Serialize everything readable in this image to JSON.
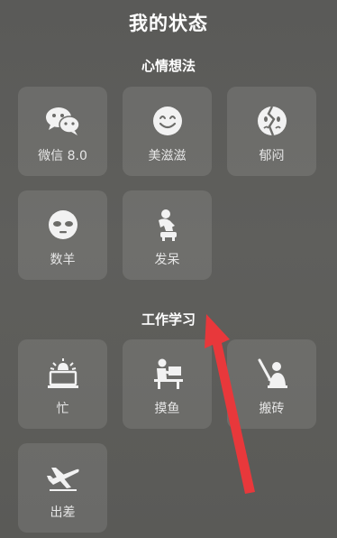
{
  "header": {
    "title": "我的状态"
  },
  "sections": [
    {
      "title": "心情想法",
      "items": [
        {
          "label": "微信 8.0",
          "icon": "wechat-icon"
        },
        {
          "label": "美滋滋",
          "icon": "smile-face-icon"
        },
        {
          "label": "郁闷",
          "icon": "broken-heart-icon"
        },
        {
          "label": "数羊",
          "icon": "sleepy-face-icon"
        },
        {
          "label": "发呆",
          "icon": "thinker-figure-icon"
        }
      ]
    },
    {
      "title": "工作学习",
      "items": [
        {
          "label": "忙",
          "icon": "alarm-laptop-icon"
        },
        {
          "label": "摸鱼",
          "icon": "person-at-desk-icon"
        },
        {
          "label": "搬砖",
          "icon": "worker-shovel-icon"
        },
        {
          "label": "出差",
          "icon": "airplane-icon"
        }
      ]
    }
  ],
  "colors": {
    "background": "#5d5d5a",
    "tile": "#6c6c69",
    "arrow": "#e8383b"
  }
}
